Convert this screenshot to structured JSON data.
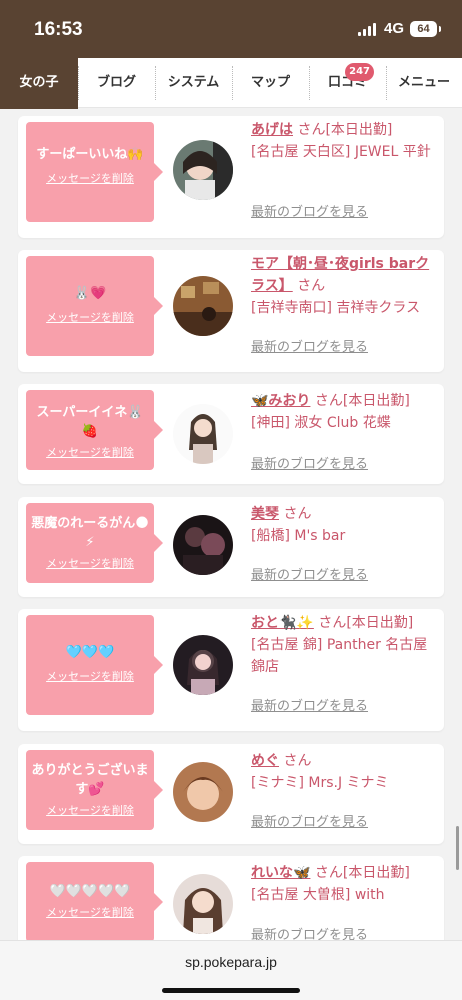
{
  "status": {
    "time": "16:53",
    "network": "4G",
    "battery": "64"
  },
  "nav": {
    "tabs": [
      {
        "label": "女の子"
      },
      {
        "label": "ブログ"
      },
      {
        "label": "システム"
      },
      {
        "label": "マップ"
      },
      {
        "label": "口コミ",
        "badge": "247"
      },
      {
        "label": "メニュー"
      }
    ],
    "active_index": 0
  },
  "delete_label": "メッセージを削除",
  "blog_label": "最新のブログを見る",
  "san": "さん",
  "items": [
    {
      "message": "すーぱーいいね🙌",
      "name": "あげは",
      "status": "[本日出勤]",
      "shop": "[名古屋 天白区] JEWEL 平針"
    },
    {
      "message": "🐰💗",
      "name": "モア【朝･昼･夜girls barクラス】",
      "status": "",
      "shop": "[吉祥寺南口] 吉祥寺クラス"
    },
    {
      "message": "スーパーイイネ🐰🍓",
      "name": "🦋みおり",
      "status": "[本日出勤]",
      "shop": "[神田] 淑女 Club 花蝶"
    },
    {
      "message": "悪魔のれーるがん🌑⚡",
      "name": "美琴",
      "status": "",
      "shop": "[船橋] M's bar"
    },
    {
      "message": "🩵🩵🩵",
      "name": "おと🐈‍⬛✨",
      "status": "[本日出勤]",
      "shop": "[名古屋 錦] Panther 名古屋 錦店"
    },
    {
      "message": "ありがとうございます💕",
      "name": "めぐ",
      "status": "",
      "shop": "[ミナミ] Mrs.J ミナミ"
    },
    {
      "message": "🤍🤍🤍🤍🤍",
      "name": "れいな🦋",
      "status": "[本日出勤]",
      "shop": "[名古屋 大曽根] with"
    }
  ],
  "url": "sp.pokepara.jp"
}
